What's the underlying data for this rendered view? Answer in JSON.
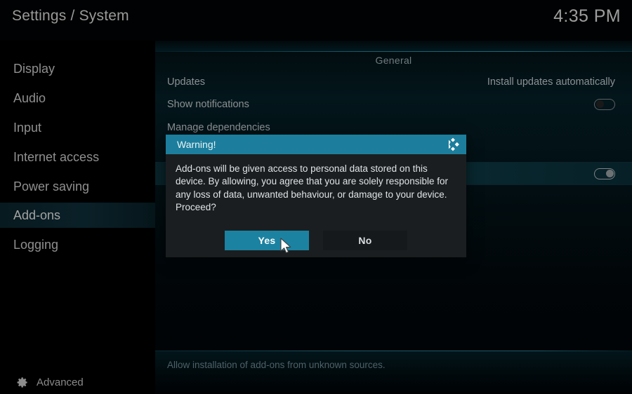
{
  "header": {
    "breadcrumb": "Settings / System",
    "clock": "4:35 PM"
  },
  "sidebar": {
    "items": [
      {
        "label": "Display",
        "selected": false
      },
      {
        "label": "Audio",
        "selected": false
      },
      {
        "label": "Input",
        "selected": false
      },
      {
        "label": "Internet access",
        "selected": false
      },
      {
        "label": "Power saving",
        "selected": false
      },
      {
        "label": "Add-ons",
        "selected": true
      },
      {
        "label": "Logging",
        "selected": false
      }
    ],
    "advanced": {
      "label": "Advanced",
      "icon": "gear-icon"
    }
  },
  "content": {
    "group_title": "General",
    "rows": [
      {
        "name": "Updates",
        "value": "Install updates automatically",
        "control": "text",
        "highlighted": false
      },
      {
        "name": "Show notifications",
        "value": "",
        "control": "toggle",
        "toggle_state": "off",
        "highlighted": false
      },
      {
        "name": "Manage dependencies",
        "value": "",
        "control": "none",
        "highlighted": false
      },
      {
        "name": "",
        "value": "",
        "control": "toggle",
        "toggle_state": "on",
        "highlighted": true
      }
    ],
    "help_text": "Allow installation of add-ons from unknown sources."
  },
  "dialog": {
    "title": "Warning!",
    "logo_icon": "kodi-logo-icon",
    "message": "Add-ons will be given access to personal data stored on this device. By allowing, you agree that you are solely responsible for any loss of data, unwanted behaviour, or damage to your device. Proceed?",
    "buttons": {
      "yes": "Yes",
      "no": "No"
    }
  },
  "colors": {
    "accent": "#1c82a1",
    "dialog_bg": "#1b1e20",
    "panel_highlight": "#0a2b33",
    "text": "#8b9195"
  }
}
